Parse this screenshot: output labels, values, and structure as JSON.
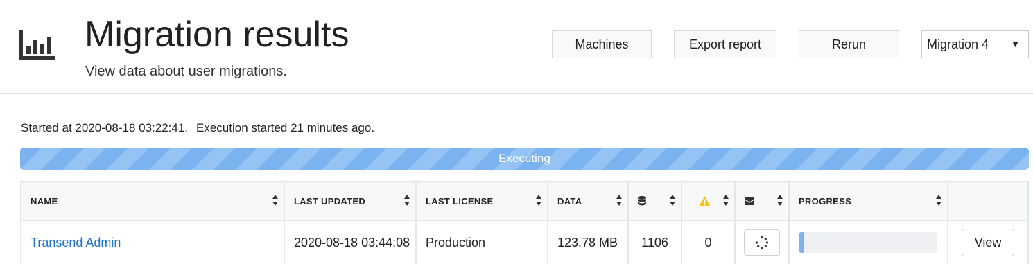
{
  "header": {
    "title": "Migration results",
    "subtitle": "View data about user migrations.",
    "icon": "bar-chart-icon"
  },
  "toolbar": {
    "machines_label": "Machines",
    "export_label": "Export report",
    "rerun_label": "Rerun",
    "migration_select": {
      "value": "Migration 4"
    }
  },
  "status": {
    "started_text": "Started at 2020-08-18 03:22:41.",
    "execution_text": "Execution started 21 minutes ago.",
    "progress_label": "Executing",
    "progress_fraction": 1.0
  },
  "table": {
    "columns": [
      {
        "label": "NAME"
      },
      {
        "label": "LAST UPDATED"
      },
      {
        "label": "LAST LICENSE"
      },
      {
        "label": "DATA"
      },
      {
        "label": "",
        "icon": "database-icon"
      },
      {
        "label": "",
        "icon": "warning-icon"
      },
      {
        "label": "",
        "icon": "envelope-icon"
      },
      {
        "label": "PROGRESS"
      },
      {
        "label": ""
      }
    ],
    "rows": [
      {
        "name": "Transend Admin",
        "last_updated": "2020-08-18 03:44:08",
        "last_license": "Production",
        "data": "123.78 MB",
        "db_count": "1106",
        "warnings": "0",
        "mail_status_icon": "spinner-icon",
        "progress_fraction": 0.04,
        "action_label": "View"
      }
    ]
  },
  "colors": {
    "accent": "#7ab3f0",
    "link": "#1d72c4",
    "warning": "#f2c518"
  }
}
